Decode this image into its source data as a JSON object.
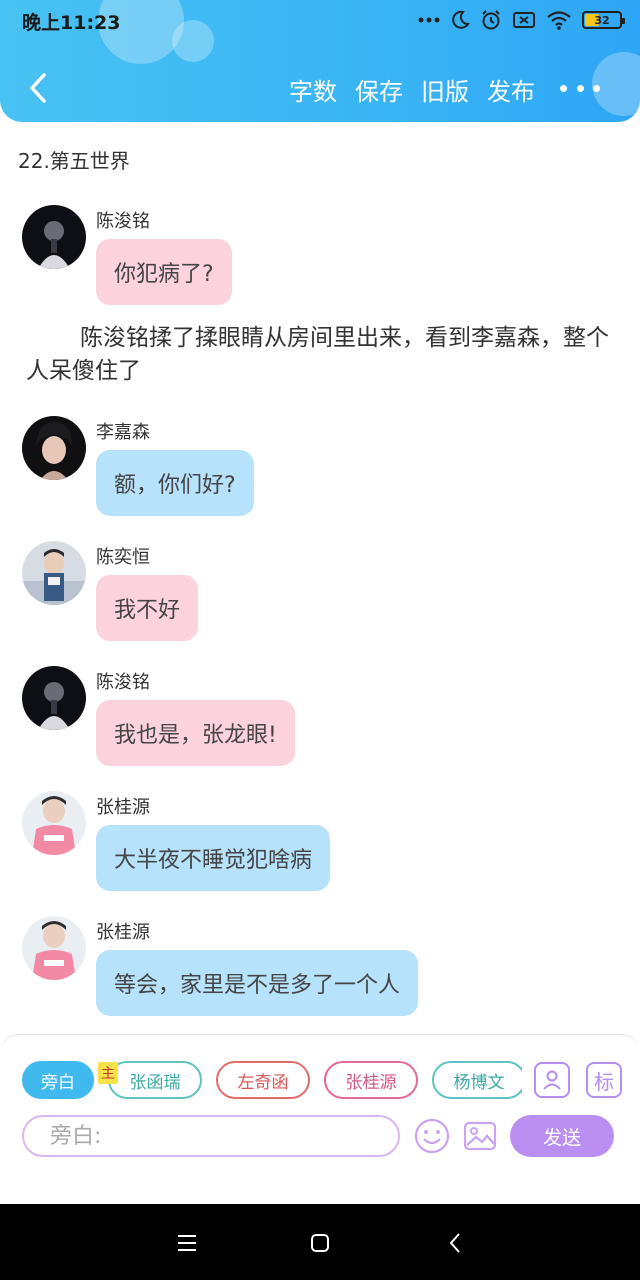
{
  "status_bar": {
    "time": "晚上11:23",
    "battery": "32"
  },
  "nav": {
    "actions": [
      "字数",
      "保存",
      "旧版",
      "发布"
    ]
  },
  "chapter_title": "22.第五世界",
  "messages": [
    {
      "speaker": "陈浚铭",
      "text": "你犯病了?"
    },
    {
      "speaker": "李嘉森",
      "text": "额，你们好?"
    },
    {
      "speaker": "陈奕恒",
      "text": "我不好"
    },
    {
      "speaker": "陈浚铭",
      "text": "我也是，张龙眼!"
    },
    {
      "speaker": "张桂源",
      "text": "大半夜不睡觉犯啥病"
    },
    {
      "speaker": "张桂源",
      "text": "等会，家里是不是多了一个人"
    }
  ],
  "narration": "陈浚铭揉了揉眼睛从房间里出来，看到李嘉森，整个人呆傻住了",
  "composer": {
    "roles": [
      "旁白",
      "张函瑞",
      "左奇函",
      "张桂源",
      "杨博文"
    ],
    "main_badge": "主",
    "tag_button": "标",
    "input_placeholder": "旁白:",
    "send_label": "发送"
  },
  "colors": {
    "header": "#39b4f4",
    "bubble_pink": "#fcd3dd",
    "bubble_blue": "#b6e2fb",
    "send": "#bb8ef2"
  }
}
